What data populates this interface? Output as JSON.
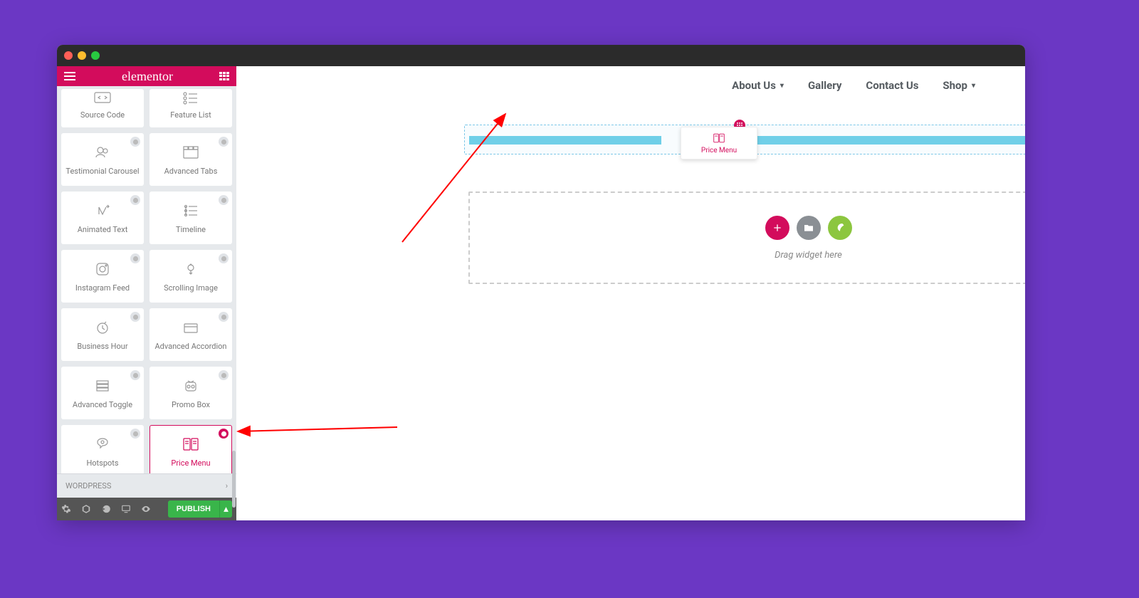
{
  "header": {
    "logo": "elementor"
  },
  "widgets": [
    {
      "id": "source-code",
      "label": "Source Code"
    },
    {
      "id": "feature-list",
      "label": "Feature List"
    },
    {
      "id": "testimonial-carousel",
      "label": "Testimonial Carousel"
    },
    {
      "id": "advanced-tabs",
      "label": "Advanced Tabs"
    },
    {
      "id": "animated-text",
      "label": "Animated Text"
    },
    {
      "id": "timeline",
      "label": "Timeline"
    },
    {
      "id": "instagram-feed",
      "label": "Instagram Feed"
    },
    {
      "id": "scrolling-image",
      "label": "Scrolling Image"
    },
    {
      "id": "business-hour",
      "label": "Business Hour"
    },
    {
      "id": "advanced-accordion",
      "label": "Advanced Accordion"
    },
    {
      "id": "advanced-toggle",
      "label": "Advanced Toggle"
    },
    {
      "id": "promo-box",
      "label": "Promo Box"
    },
    {
      "id": "hotspots",
      "label": "Hotspots"
    },
    {
      "id": "price-menu",
      "label": "Price Menu",
      "selected": true
    }
  ],
  "category": {
    "label": "WORDPRESS"
  },
  "footer": {
    "publish": "PUBLISH"
  },
  "nav": {
    "items": [
      {
        "label": "About Us",
        "dropdown": true
      },
      {
        "label": "Gallery",
        "dropdown": false
      },
      {
        "label": "Contact Us",
        "dropdown": false
      },
      {
        "label": "Shop",
        "dropdown": true
      }
    ]
  },
  "drag": {
    "ghost_label": "Price Menu",
    "hint": "Drag widget here"
  }
}
